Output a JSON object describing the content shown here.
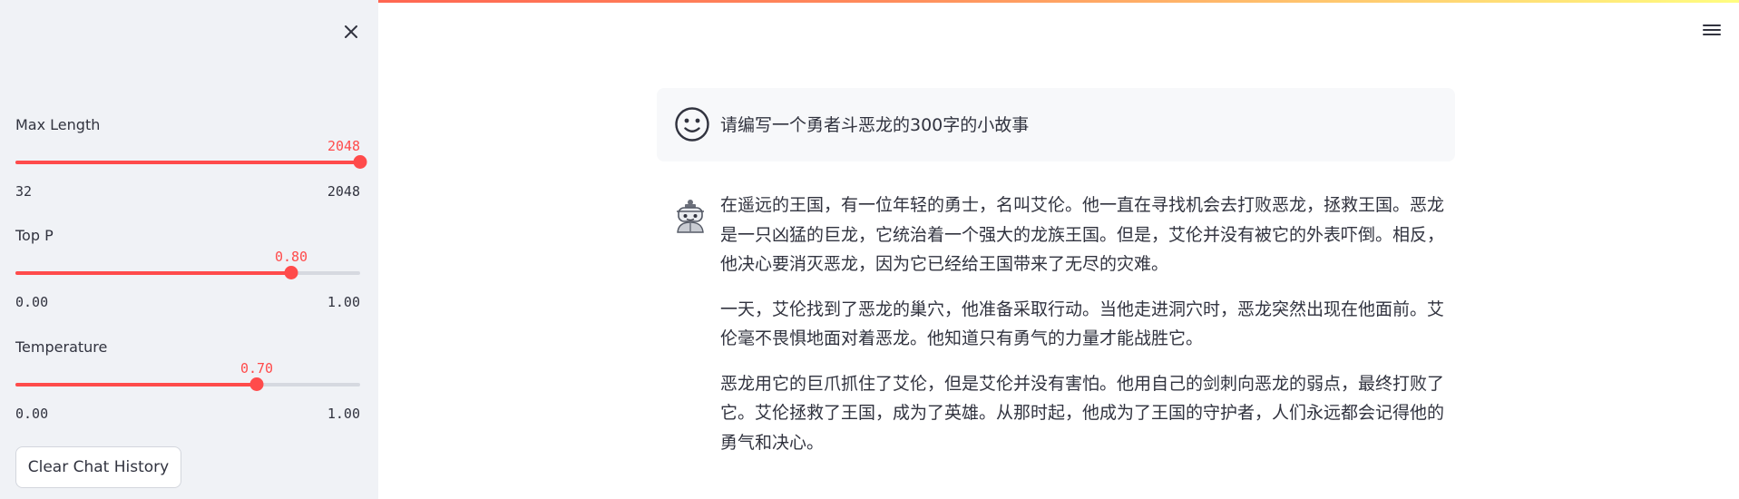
{
  "sidebar": {
    "sliders": [
      {
        "label": "Max Length",
        "value": "2048",
        "min": "32",
        "max": "2048",
        "fraction": 1.0
      },
      {
        "label": "Top P",
        "value": "0.80",
        "min": "0.00",
        "max": "1.00",
        "fraction": 0.8
      },
      {
        "label": "Temperature",
        "value": "0.70",
        "min": "0.00",
        "max": "1.00",
        "fraction": 0.7
      }
    ],
    "clear_button_label": "Clear Chat History",
    "close_icon": "close-icon"
  },
  "header": {
    "menu_icon": "hamburger-menu-icon"
  },
  "chat": {
    "user_message": "请编写一个勇者斗恶龙的300字的小故事",
    "assistant_paragraphs": [
      "在遥远的王国，有一位年轻的勇士，名叫艾伦。他一直在寻找机会去打败恶龙，拯救王国。恶龙是一只凶猛的巨龙，它统治着一个强大的龙族王国。但是，艾伦并没有被它的外表吓倒。相反，他决心要消灭恶龙，因为它已经给王国带来了无尽的灾难。",
      "一天，艾伦找到了恶龙的巢穴，他准备采取行动。当他走进洞穴时，恶龙突然出现在他面前。艾伦毫不畏惧地面对着恶龙。他知道只有勇气的力量才能战胜它。",
      "恶龙用它的巨爪抓住了艾伦，但是艾伦并没有害怕。他用自己的剑刺向恶龙的弱点，最终打败了它。艾伦拯救了王国，成为了英雄。从那时起，他成为了王国的守护者，人们永远都会记得他的勇气和决心。"
    ]
  },
  "colors": {
    "accent": "#ff4b4b",
    "sidebar_bg": "#f0f2f6",
    "text": "#31333f"
  }
}
